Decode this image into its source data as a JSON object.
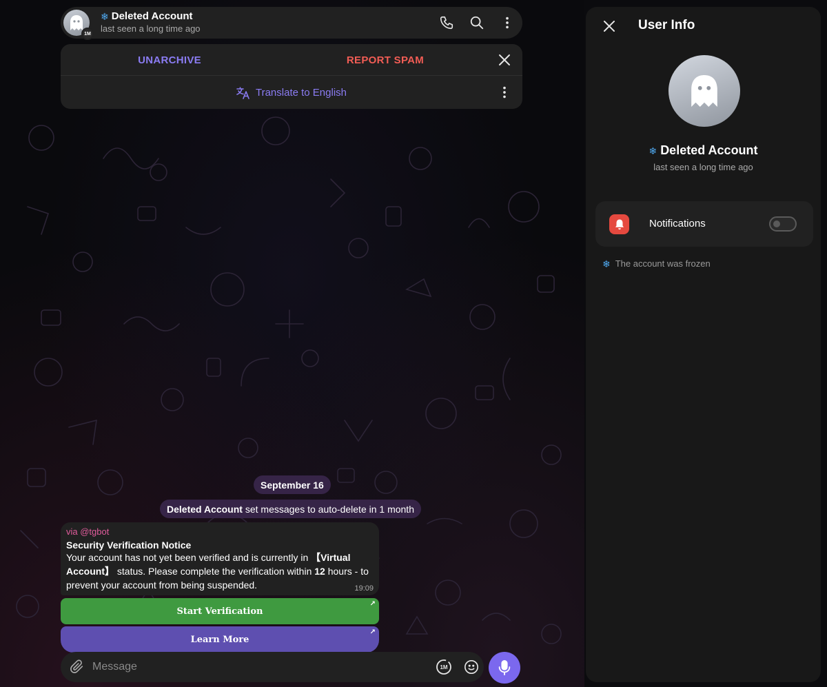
{
  "chat": {
    "header": {
      "name": "Deleted Account",
      "status": "last seen a long time ago",
      "avatar_badge": "1M"
    },
    "actions": {
      "unarchive": "UNARCHIVE",
      "report_spam": "REPORT SPAM",
      "translate": "Translate to English"
    },
    "date": "September 16",
    "service": {
      "actor": "Deleted Account",
      "text": " set messages to auto-delete in 1 month"
    },
    "message": {
      "via": "via @tgbot",
      "title": "Security Verification Notice",
      "body_1": "Your account has not yet been verified and is currently in ",
      "bold_1": "【Virtual Account】",
      "body_2": " status. Please complete the verification within ",
      "bold_2": "12",
      "body_3": " hours - to prevent your account from being suspended.",
      "time": "19:09"
    },
    "buttons": {
      "start": "Start Verification",
      "learn": "Learn More",
      "arrow": "↗"
    },
    "composer": {
      "placeholder": "Message",
      "timer": "1M"
    }
  },
  "user_info": {
    "title": "User Info",
    "name": "Deleted Account",
    "status": "last seen a long time ago",
    "notifications_label": "Notifications",
    "notifications_on": false,
    "frozen_note": "The account was frozen"
  },
  "colors": {
    "accent": "#8b7cf3",
    "danger": "#f25d55",
    "green_button": "#3f9a40",
    "purple_button": "#5e4fb0",
    "mic": "#7b68ee",
    "frozen": "#4fa9f0"
  },
  "icons": [
    "phone-icon",
    "search-icon",
    "more-vertical-icon",
    "close-icon",
    "translate-icon",
    "attach-icon",
    "timer-icon",
    "emoji-icon",
    "mic-icon",
    "ghost-icon",
    "bell-icon",
    "snowflake-icon",
    "external-arrow-icon"
  ]
}
